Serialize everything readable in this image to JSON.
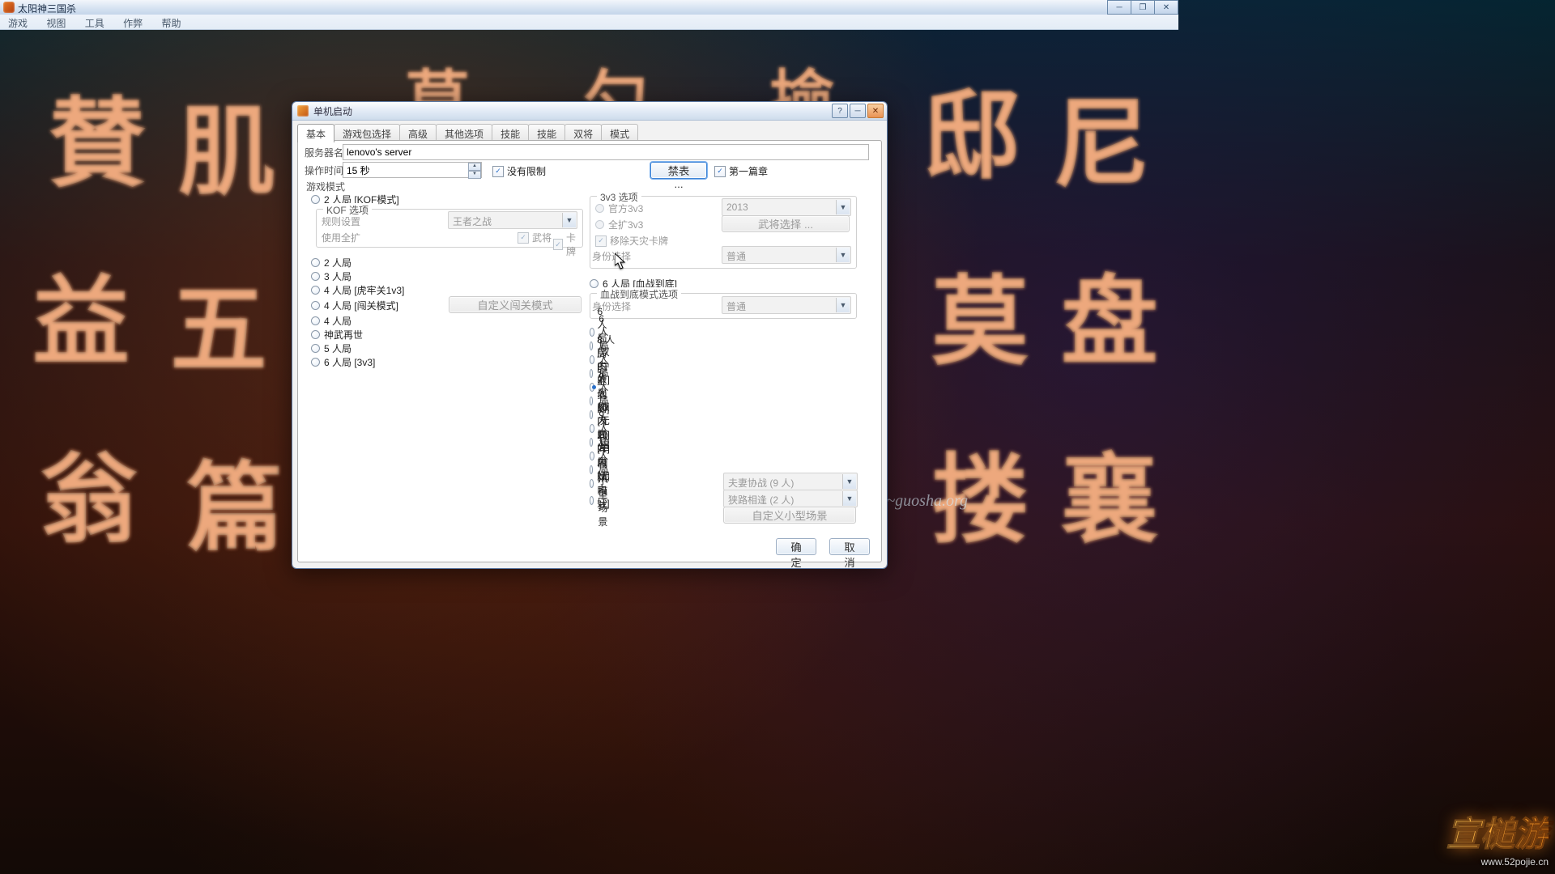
{
  "app": {
    "title": "太阳神三国杀",
    "menus": [
      "游戏",
      "视图",
      "工具",
      "作弊",
      "帮助"
    ]
  },
  "bg": {
    "url_right": "~guosha.org"
  },
  "dialog": {
    "title": "单机启动",
    "tabs": [
      "基本",
      "游戏包选择",
      "高级",
      "其他选项",
      "技能",
      "技能",
      "双将",
      "模式"
    ],
    "active_tab": 0,
    "server_name_label": "服务器名",
    "server_name_value": "lenovo's server",
    "op_time_label": "操作时间",
    "op_time_value": "15 秒",
    "no_limit_label": "没有限制",
    "ban_list_btn": "禁表 ...",
    "chapter1_label": "第一篇章",
    "mode_header": "游戏模式",
    "left_radios": [
      "2 人局 [KOF模式]",
      "2 人局",
      "3 人局",
      "4 人局 [虎牢关1v3]",
      "4 人局 [闯关模式]",
      "4 人局",
      "神武再世",
      "5 人局",
      "6 人局 [3v3]"
    ],
    "kof": {
      "box_title": "KOF 选项",
      "rule_label": "规则设置",
      "rule_value": "王者之战",
      "use_all_label": "使用全扩",
      "wujiang_label": "武将",
      "kapai_label": "卡牌"
    },
    "custom_stage_btn": "自定义闯关模式",
    "threev3": {
      "box_title": "3v3 选项",
      "official": "官方3v3",
      "allext": "全扩3v3",
      "year_value": "2013",
      "sel_gen_btn": "武将选择 ...",
      "remove_td": "移除天灾卡牌",
      "role_sel_label": "身份选择",
      "role_sel_value": "普通"
    },
    "right_radios_top": "6 人局 [血战到底]",
    "bloodfight": {
      "box_title": "血战到底模式选项",
      "role_sel_label": "身份选择",
      "role_sel_value": "普通"
    },
    "right_radios": [
      "6 人局",
      "6 人局 [双内奸]",
      "7 人局",
      "8 人局 [守卫剑阁]",
      "8 人局",
      "8 人局 [双内奸]",
      "8 人局 [无内奸]",
      "9 人局",
      "10 人局 [单内奸]",
      "10 人局",
      "10 人局 [无内奸]",
      "剧情模式",
      "小型场景"
    ],
    "right_radios_selected": 4,
    "drama_value": "夫妻协战 (9 人)",
    "mini_value": "狭路相逢 (2 人)",
    "custom_mini_btn": "自定义小型场景",
    "ok": "确定",
    "cancel": "取消"
  },
  "watermark": {
    "logo": "宣槌游",
    "url": "www.52pojie.cn"
  }
}
